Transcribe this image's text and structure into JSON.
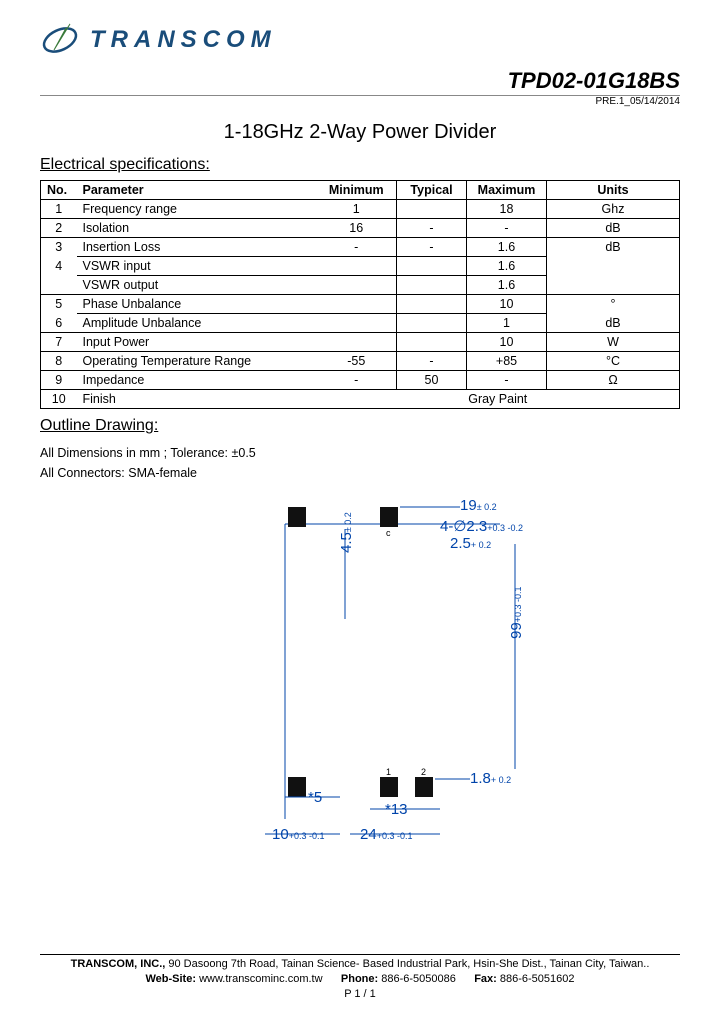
{
  "brand": {
    "name": "TRANSCOM"
  },
  "part": {
    "number": "TPD02-01G18BS",
    "rev": "PRE.1_05/14/2014"
  },
  "title": "1-18GHz 2-Way Power Divider",
  "sections": {
    "elec": "Electrical specifications:",
    "outline": "Outline Drawing:"
  },
  "table": {
    "headers": {
      "no": "No.",
      "param": "Parameter",
      "min": "Minimum",
      "typ": "Typical",
      "max": "Maximum",
      "units": "Units"
    },
    "rows": [
      {
        "no": "1",
        "param": "Frequency range",
        "min": "1",
        "typ": "",
        "max": "18",
        "units": "Ghz"
      },
      {
        "no": "2",
        "param": "Isolation",
        "min": "16",
        "typ": "-",
        "max": "-",
        "units": "dB"
      },
      {
        "no": "3",
        "param": "Insertion Loss",
        "min": "-",
        "typ": "-",
        "max": "1.6",
        "units": "dB"
      },
      {
        "no": "4",
        "param": "VSWR input",
        "min": "",
        "typ": "",
        "max": "1.6",
        "units": ""
      },
      {
        "no": "",
        "param": "VSWR output",
        "min": "",
        "typ": "",
        "max": "1.6",
        "units": ""
      },
      {
        "no": "5",
        "param": "Phase Unbalance",
        "min": "",
        "typ": "",
        "max": "10",
        "units": "°"
      },
      {
        "no": "6",
        "param": "Amplitude Unbalance",
        "min": "",
        "typ": "",
        "max": "1",
        "units": "dB"
      },
      {
        "no": "7",
        "param": "Input Power",
        "min": "",
        "typ": "",
        "max": "10",
        "units": "W"
      },
      {
        "no": "8",
        "param": "Operating Temperature Range",
        "min": "-55",
        "typ": "-",
        "max": "+85",
        "units": "°C"
      },
      {
        "no": "9",
        "param": "Impedance",
        "min": "-",
        "typ": "50",
        "max": "-",
        "units": "Ω"
      },
      {
        "no": "10",
        "param": "Finish",
        "min": "",
        "typ": "",
        "max": "",
        "units": "",
        "span": "Gray Paint"
      }
    ]
  },
  "notes": {
    "line1": "All Dimensions in mm ; Tolerance: ±0.5",
    "line2": "All Connectors: SMA-female"
  },
  "drawing": {
    "dim_19": "19",
    "tol_19": "± 0.2",
    "dim_4d": "4-∅2.3",
    "tol_4d": "+0.3 -0.2",
    "dim_2_5": "2.5",
    "tol_2_5": "+ 0.2",
    "dim_4_5": "4.5",
    "tol_4_5": "± 0.2",
    "dim_99": "99",
    "tol_99": "+0.3 -0.1",
    "dim_1_8": "1.8",
    "tol_1_8": "+ 0.2",
    "dim_star5": "*5",
    "dim_star13": "*13",
    "dim_10": "10",
    "tol_10": "+0.3 -0.1",
    "dim_24": "24",
    "tol_24": "+0.3 -0.1",
    "label_c": "c",
    "label_1": "1",
    "label_2": "2"
  },
  "footer": {
    "company": "TRANSCOM, INC.,",
    "addr": " 90 Dasoong 7th Road, Tainan Science- Based Industrial Park, Hsin-She Dist., Tainan City, Taiwan..",
    "web_l": "Web-Site:",
    "web": " www.transcominc.com.tw",
    "phone_l": "Phone:",
    "phone": " 886-6-5050086",
    "fax_l": "Fax:",
    "fax": " 886-6-5051602",
    "page": "P 1 / 1"
  }
}
